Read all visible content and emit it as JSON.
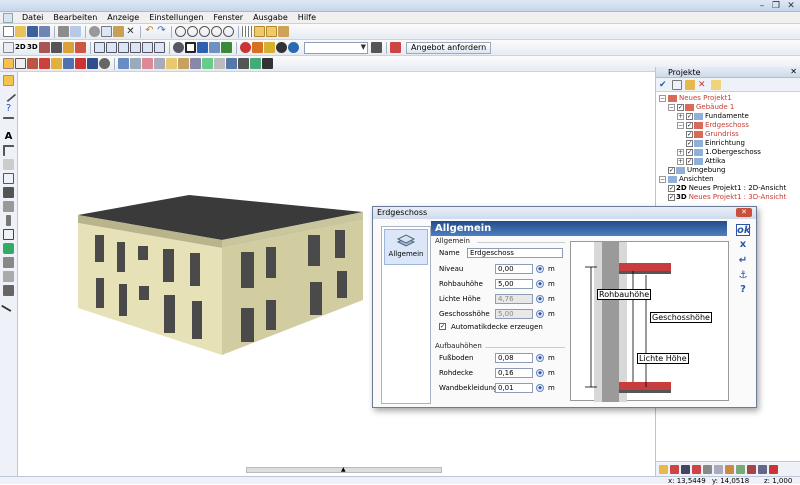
{
  "menu": [
    "Datei",
    "Bearbeiten",
    "Anzeige",
    "Einstellungen",
    "Fenster",
    "Ausgabe",
    "Hilfe"
  ],
  "toolbar": {
    "mode_2d": "2D",
    "mode_3d": "3D",
    "offer_label": "Angebot anfordern",
    "combo_value": ""
  },
  "left_toolbar": {
    "text_tool": "A"
  },
  "panel": {
    "title": "Projekte",
    "tree": [
      {
        "label": "Neues Projekt1",
        "red": true,
        "level": 0,
        "exp": "-",
        "cb": false
      },
      {
        "label": "Gebäude 1",
        "red": true,
        "level": 1,
        "exp": "-",
        "cb": true
      },
      {
        "label": "Fundamente",
        "red": false,
        "level": 2,
        "exp": "+",
        "cb": true
      },
      {
        "label": "Erdgeschoss",
        "red": true,
        "level": 2,
        "exp": "-",
        "cb": true
      },
      {
        "label": "Grundriss",
        "red": true,
        "level": 3,
        "exp": "",
        "cb": true
      },
      {
        "label": "Einrichtung",
        "red": false,
        "level": 3,
        "exp": "",
        "cb": true
      },
      {
        "label": "1.Obergeschoss",
        "red": false,
        "level": 2,
        "exp": "+",
        "cb": true
      },
      {
        "label": "Attika",
        "red": false,
        "level": 2,
        "exp": "+",
        "cb": true
      },
      {
        "label": "Umgebung",
        "red": false,
        "level": 1,
        "exp": "",
        "cb": true
      },
      {
        "label": "Ansichten",
        "red": false,
        "level": 0,
        "exp": "-",
        "cb": false
      },
      {
        "label": "Neues Projekt1 : 2D-Ansicht",
        "red": false,
        "level": 1,
        "exp": "",
        "cb": true,
        "tag": "2D"
      },
      {
        "label": "Neues Projekt1 : 3D-Ansicht",
        "red": true,
        "level": 1,
        "exp": "",
        "cb": true,
        "tag": "3D"
      }
    ]
  },
  "dialog": {
    "title": "Erdgeschoss",
    "header": "Allgemein",
    "nav_item": "Allgemein",
    "group_general": "Allgemein",
    "name_label": "Name",
    "name_value": "Erdgeschoss",
    "group_heights": "Aufbauhöhen",
    "checkbox_label": "Automatikdecke erzeugen",
    "unit": "m",
    "side_buttons": {
      "ok": "ok",
      "cancel": "x",
      "enter": "↵",
      "anchor": "⚓",
      "help": "?"
    },
    "rows": [
      {
        "label": "Niveau",
        "value": "0,00",
        "disabled": false
      },
      {
        "label": "Rohbauhöhe",
        "value": "5,00",
        "disabled": false
      },
      {
        "label": "Lichte Höhe",
        "value": "4,76",
        "disabled": true
      },
      {
        "label": "Geschosshöhe",
        "value": "5,00",
        "disabled": true
      }
    ],
    "rows2": [
      {
        "label": "Fußboden",
        "value": "0,08"
      },
      {
        "label": "Rohdecke",
        "value": "0,16"
      },
      {
        "label": "Wandbekleidung",
        "value": "0,01"
      }
    ],
    "diagram_labels": {
      "rohbau": "Rohbauhöhe",
      "geschoss": "Geschosshöhe",
      "lichte": "Lichte Höhe"
    }
  },
  "status": {
    "x": "x: 13,5449",
    "y": "y: 14,0518",
    "z": "z: 1,000"
  }
}
